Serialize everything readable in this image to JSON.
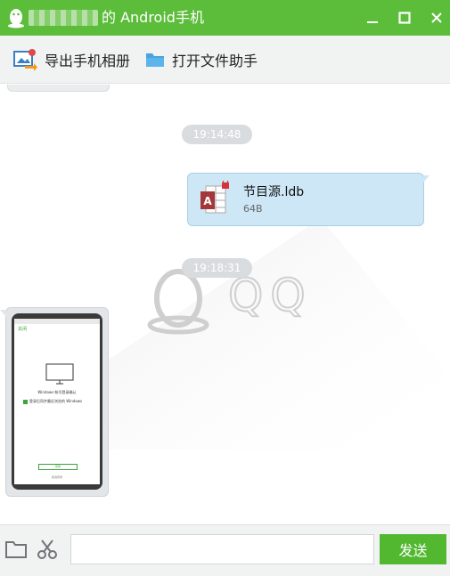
{
  "window": {
    "title": "的 Android手机",
    "minimize_icon": "minimize-icon",
    "maximize_icon": "maximize-icon",
    "close_icon": "close-icon",
    "bar_color": "#5cbd3a"
  },
  "toolbar": {
    "export_album_label": "导出手机相册",
    "open_file_helper_label": "打开文件助手",
    "export_icon": "photo-export-icon",
    "folder_icon": "folder-icon"
  },
  "messages": [
    {
      "type": "time",
      "text": "19:14:48"
    },
    {
      "type": "file",
      "name": "节目源.ldb",
      "size": "64B",
      "icon": "access-database-file-icon"
    },
    {
      "type": "time",
      "text": "19:18:31"
    },
    {
      "type": "image",
      "preview": {
        "header": "关闭",
        "line1": "Windows 帐号登录确认",
        "line2": "登录后同步最近浏览的 Windows",
        "button": "登录",
        "footer": "取消登录"
      }
    }
  ],
  "watermark": {
    "text": "QQ"
  },
  "bottom": {
    "folder_icon": "folder-icon",
    "scissors_icon": "scissors-icon",
    "input_value": "",
    "send_label": "发送",
    "send_color": "#52b830"
  }
}
